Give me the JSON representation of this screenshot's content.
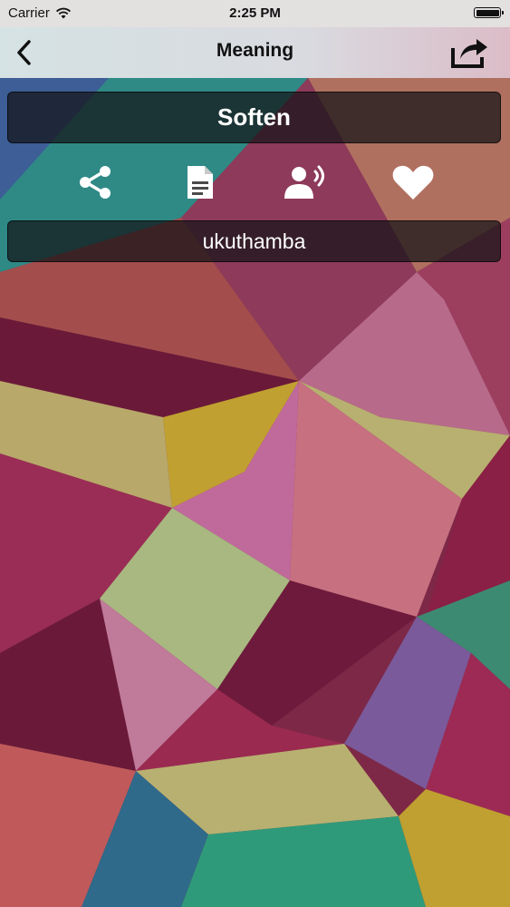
{
  "status_bar": {
    "carrier": "Carrier",
    "time": "2:25 PM",
    "wifi_icon": "wifi-icon",
    "battery_icon": "battery-icon"
  },
  "nav": {
    "title": "Meaning",
    "back_icon": "chevron-left-icon",
    "share_icon": "share-box-icon"
  },
  "word": "Soften",
  "actions": [
    {
      "name": "share",
      "icon": "share-icon"
    },
    {
      "name": "copy",
      "icon": "document-icon"
    },
    {
      "name": "speak",
      "icon": "speaker-person-icon"
    },
    {
      "name": "favorite",
      "icon": "heart-icon"
    }
  ],
  "meaning": "ukuthamba",
  "colors": {
    "panel_bg": "#141416",
    "text_light": "#ffffff",
    "nav_text": "#111111"
  }
}
